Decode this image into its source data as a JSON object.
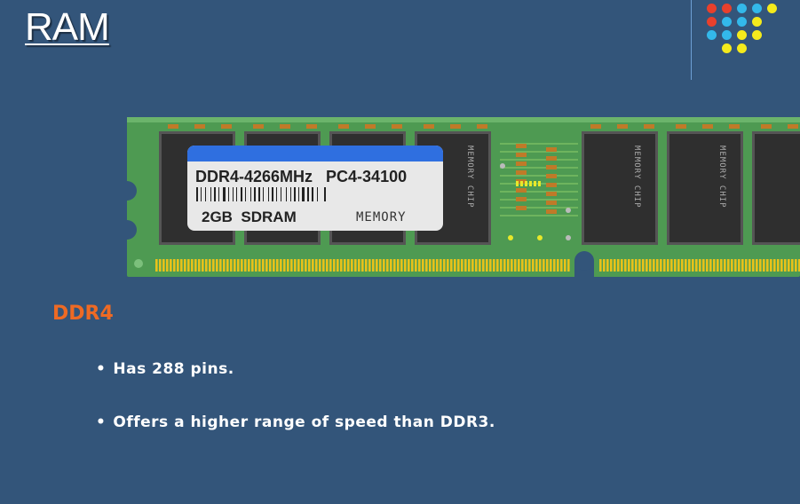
{
  "slide": {
    "title": "RAM",
    "section_heading": "DDR4",
    "bullets": [
      "Has 288 pins.",
      "Offers a higher range of speed than DDR3."
    ],
    "bullet_marker": "•"
  },
  "ram_image": {
    "label_line1": "DDR4-4266MHz   PC4-34100",
    "label_line2": "2GB  SDRAM",
    "label_brand": "MEMORY",
    "chip_text": "MEMORY CHIP"
  },
  "colors": {
    "background": "#33557a",
    "heading_orange": "#ee6a24",
    "pcb_green": "#4e9a52",
    "label_accent_blue": "#2f6fe0",
    "dot_red": "#e8402c",
    "dot_blue": "#33b8ea",
    "dot_yellow": "#f4ea1c"
  }
}
